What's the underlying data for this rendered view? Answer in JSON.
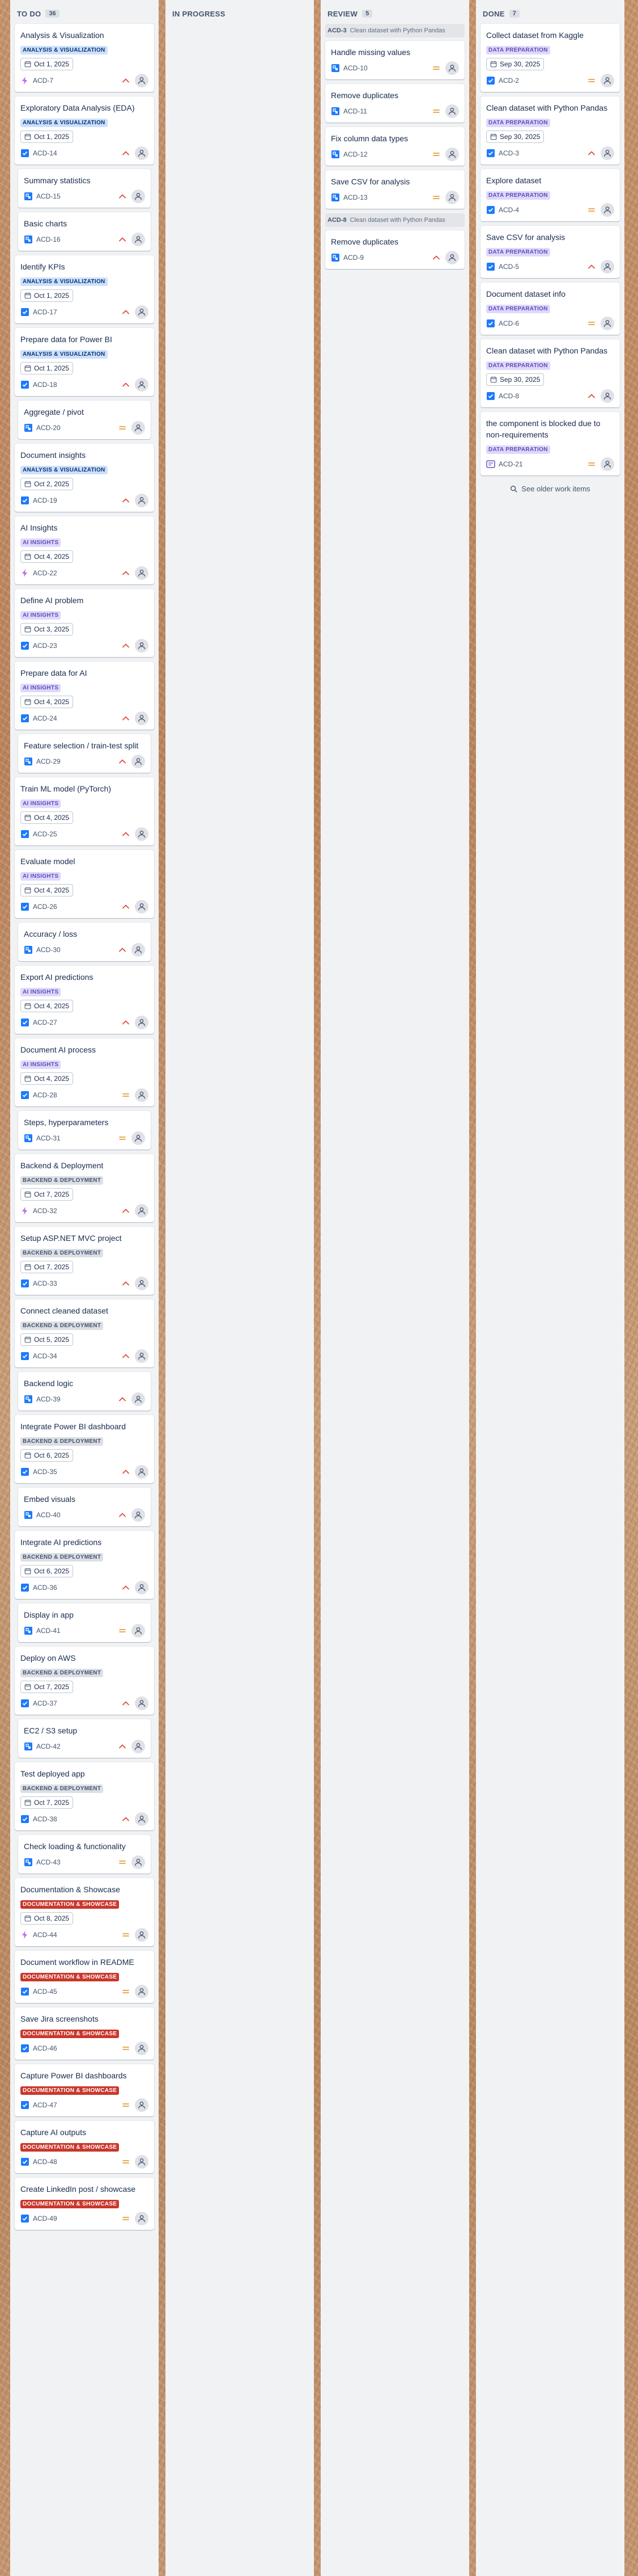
{
  "colors": {
    "analysis": {
      "bg": "#cce0ff",
      "fg": "#09326c"
    },
    "ai": {
      "bg": "#dfd8fd",
      "fg": "#5e4db2"
    },
    "backend": {
      "bg": "#dcdfe4",
      "fg": "#44546f"
    },
    "docs": {
      "bg": "#c9372c",
      "fg": "#ffffff"
    },
    "dataprep": {
      "bg": "#dfd8fd",
      "fg": "#5e4db2"
    }
  },
  "columns": {
    "todo": {
      "title": "TO DO",
      "count": "36",
      "cards": [
        {
          "title": "Analysis & Visualization",
          "epic": "ANALYSIS & VISUALIZATION",
          "epic_style": "analysis",
          "date": "Oct 1, 2025",
          "key": "ACD-7",
          "type": "epic-icon",
          "priority": "high-priority-icon"
        },
        {
          "title": "Exploratory Data Analysis (EDA)",
          "epic": "ANALYSIS & VISUALIZATION",
          "epic_style": "analysis",
          "date": "Oct 1, 2025",
          "key": "ACD-14",
          "type": "task-icon",
          "priority": "high-priority-icon"
        },
        {
          "title": "Summary statistics",
          "key": "ACD-15",
          "type": "subtask-icon",
          "priority": "high-priority-icon",
          "sub": true
        },
        {
          "title": "Basic charts",
          "key": "ACD-16",
          "type": "subtask-icon",
          "priority": "high-priority-icon",
          "sub": true
        },
        {
          "title": "Identify KPIs",
          "epic": "ANALYSIS & VISUALIZATION",
          "epic_style": "analysis",
          "date": "Oct 1, 2025",
          "key": "ACD-17",
          "type": "task-icon",
          "priority": "high-priority-icon"
        },
        {
          "title": "Prepare data for Power BI",
          "epic": "ANALYSIS & VISUALIZATION",
          "epic_style": "analysis",
          "date": "Oct 1, 2025",
          "key": "ACD-18",
          "type": "task-icon",
          "priority": "high-priority-icon"
        },
        {
          "title": "Aggregate / pivot",
          "key": "ACD-20",
          "type": "subtask-icon",
          "priority": "medium-priority-icon",
          "sub": true
        },
        {
          "title": "Document insights",
          "epic": "ANALYSIS & VISUALIZATION",
          "epic_style": "analysis",
          "date": "Oct 2, 2025",
          "key": "ACD-19",
          "type": "task-icon",
          "priority": "high-priority-icon"
        },
        {
          "title": "AI Insights",
          "epic": "AI INSIGHTS",
          "epic_style": "ai",
          "date": "Oct 4, 2025",
          "key": "ACD-22",
          "type": "epic-icon",
          "priority": "high-priority-icon"
        },
        {
          "title": "Define AI problem",
          "epic": "AI INSIGHTS",
          "epic_style": "ai",
          "date": "Oct 3, 2025",
          "key": "ACD-23",
          "type": "task-icon",
          "priority": "high-priority-icon"
        },
        {
          "title": "Prepare data for AI",
          "epic": "AI INSIGHTS",
          "epic_style": "ai",
          "date": "Oct 4, 2025",
          "key": "ACD-24",
          "type": "task-icon",
          "priority": "high-priority-icon"
        },
        {
          "title": "Feature selection / train-test split",
          "key": "ACD-29",
          "type": "subtask-icon",
          "priority": "high-priority-icon",
          "sub": true
        },
        {
          "title": "Train ML model (PyTorch)",
          "epic": "AI INSIGHTS",
          "epic_style": "ai",
          "date": "Oct 4, 2025",
          "key": "ACD-25",
          "type": "task-icon",
          "priority": "high-priority-icon"
        },
        {
          "title": "Evaluate model",
          "epic": "AI INSIGHTS",
          "epic_style": "ai",
          "date": "Oct 4, 2025",
          "key": "ACD-26",
          "type": "task-icon",
          "priority": "high-priority-icon"
        },
        {
          "title": "Accuracy / loss",
          "key": "ACD-30",
          "type": "subtask-icon",
          "priority": "high-priority-icon",
          "sub": true
        },
        {
          "title": "Export AI predictions",
          "epic": "AI INSIGHTS",
          "epic_style": "ai",
          "date": "Oct 4, 2025",
          "key": "ACD-27",
          "type": "task-icon",
          "priority": "high-priority-icon"
        },
        {
          "title": "Document AI process",
          "epic": "AI INSIGHTS",
          "epic_style": "ai",
          "date": "Oct 4, 2025",
          "key": "ACD-28",
          "type": "task-icon",
          "priority": "medium-priority-icon"
        },
        {
          "title": "Steps, hyperparameters",
          "key": "ACD-31",
          "type": "subtask-icon",
          "priority": "medium-priority-icon",
          "sub": true
        },
        {
          "title": "Backend & Deployment",
          "epic": "BACKEND & DEPLOYMENT",
          "epic_style": "backend",
          "date": "Oct 7, 2025",
          "key": "ACD-32",
          "type": "epic-icon",
          "priority": "high-priority-icon"
        },
        {
          "title": "Setup ASP.NET MVC project",
          "epic": "BACKEND & DEPLOYMENT",
          "epic_style": "backend",
          "date": "Oct 7, 2025",
          "key": "ACD-33",
          "type": "task-icon",
          "priority": "high-priority-icon"
        },
        {
          "title": "Connect cleaned dataset",
          "epic": "BACKEND & DEPLOYMENT",
          "epic_style": "backend",
          "date": "Oct 5, 2025",
          "key": "ACD-34",
          "type": "task-icon",
          "priority": "high-priority-icon"
        },
        {
          "title": "Backend logic",
          "key": "ACD-39",
          "type": "subtask-icon",
          "priority": "high-priority-icon",
          "sub": true
        },
        {
          "title": "Integrate Power BI dashboard",
          "epic": "BACKEND & DEPLOYMENT",
          "epic_style": "backend",
          "date": "Oct 6, 2025",
          "key": "ACD-35",
          "type": "task-icon",
          "priority": "high-priority-icon"
        },
        {
          "title": "Embed visuals",
          "key": "ACD-40",
          "type": "subtask-icon",
          "priority": "high-priority-icon",
          "sub": true
        },
        {
          "title": "Integrate AI predictions",
          "epic": "BACKEND & DEPLOYMENT",
          "epic_style": "backend",
          "date": "Oct 6, 2025",
          "key": "ACD-36",
          "type": "task-icon",
          "priority": "high-priority-icon"
        },
        {
          "title": "Display in app",
          "key": "ACD-41",
          "type": "subtask-icon",
          "priority": "medium-priority-icon",
          "sub": true
        },
        {
          "title": "Deploy on AWS",
          "epic": "BACKEND & DEPLOYMENT",
          "epic_style": "backend",
          "date": "Oct 7, 2025",
          "key": "ACD-37",
          "type": "task-icon",
          "priority": "high-priority-icon"
        },
        {
          "title": "EC2 / S3 setup",
          "key": "ACD-42",
          "type": "subtask-icon",
          "priority": "high-priority-icon",
          "sub": true
        },
        {
          "title": "Test deployed app",
          "epic": "BACKEND & DEPLOYMENT",
          "epic_style": "backend",
          "date": "Oct 7, 2025",
          "key": "ACD-38",
          "type": "task-icon",
          "priority": "high-priority-icon"
        },
        {
          "title": "Check loading & functionality",
          "key": "ACD-43",
          "type": "subtask-icon",
          "priority": "medium-priority-icon",
          "sub": true
        },
        {
          "title": "Documentation & Showcase",
          "epic": "DOCUMENTATION & SHOWCASE",
          "epic_style": "docs",
          "date": "Oct 8, 2025",
          "key": "ACD-44",
          "type": "epic-icon",
          "priority": "medium-priority-icon"
        },
        {
          "title": "Document workflow in README",
          "epic": "DOCUMENTATION & SHOWCASE",
          "epic_style": "docs",
          "key": "ACD-45",
          "type": "task-icon",
          "priority": "medium-priority-icon"
        },
        {
          "title": "Save Jira screenshots",
          "epic": "DOCUMENTATION & SHOWCASE",
          "epic_style": "docs",
          "key": "ACD-46",
          "type": "task-icon",
          "priority": "medium-priority-icon"
        },
        {
          "title": "Capture Power BI dashboards",
          "epic": "DOCUMENTATION & SHOWCASE",
          "epic_style": "docs",
          "key": "ACD-47",
          "type": "task-icon",
          "priority": "medium-priority-icon"
        },
        {
          "title": "Capture AI outputs",
          "epic": "DOCUMENTATION & SHOWCASE",
          "epic_style": "docs",
          "key": "ACD-48",
          "type": "task-icon",
          "priority": "medium-priority-icon"
        },
        {
          "title": "Create LinkedIn post / showcase",
          "epic": "DOCUMENTATION & SHOWCASE",
          "epic_style": "docs",
          "key": "ACD-49",
          "type": "task-icon",
          "priority": "medium-priority-icon"
        }
      ]
    },
    "inprogress": {
      "title": "IN PROGRESS"
    },
    "review": {
      "title": "REVIEW",
      "count": "5",
      "groups": [
        {
          "key": "ACD-3",
          "name": "Clean dataset with Python Pandas",
          "cards": [
            {
              "title": "Handle missing values",
              "key": "ACD-10",
              "type": "subtask-icon",
              "priority": "medium-priority-icon"
            },
            {
              "title": "Remove duplicates",
              "key": "ACD-11",
              "type": "subtask-icon",
              "priority": "medium-priority-icon"
            },
            {
              "title": "Fix column data types",
              "key": "ACD-12",
              "type": "subtask-icon",
              "priority": "medium-priority-icon"
            },
            {
              "title": "Save CSV for analysis",
              "key": "ACD-13",
              "type": "subtask-icon",
              "priority": "medium-priority-icon"
            }
          ]
        },
        {
          "key": "ACD-8",
          "name": "Clean dataset with Python Pandas",
          "cards": [
            {
              "title": "Remove duplicates",
              "key": "ACD-9",
              "type": "subtask-icon",
              "priority": "high-priority-icon"
            }
          ]
        }
      ]
    },
    "done": {
      "title": "DONE",
      "count": "7",
      "cards": [
        {
          "title": "Collect dataset from Kaggle",
          "epic": "DATA PREPARATION",
          "epic_style": "dataprep",
          "date": "Sep 30, 2025",
          "key": "ACD-2",
          "type": "task-icon",
          "priority": "medium-priority-icon"
        },
        {
          "title": "Clean dataset with Python Pandas",
          "epic": "DATA PREPARATION",
          "epic_style": "dataprep",
          "date": "Sep 30, 2025",
          "key": "ACD-3",
          "type": "task-icon",
          "priority": "high-priority-icon"
        },
        {
          "title": "Explore dataset",
          "epic": "DATA PREPARATION",
          "epic_style": "dataprep",
          "key": "ACD-4",
          "type": "task-icon",
          "priority": "medium-priority-icon"
        },
        {
          "title": "Save CSV for analysis",
          "epic": "DATA PREPARATION",
          "epic_style": "dataprep",
          "key": "ACD-5",
          "type": "task-icon",
          "priority": "high-priority-icon"
        },
        {
          "title": "Document dataset info",
          "epic": "DATA PREPARATION",
          "epic_style": "dataprep",
          "key": "ACD-6",
          "type": "task-icon",
          "priority": "medium-priority-icon"
        },
        {
          "title": "Clean dataset with Python Pandas",
          "epic": "DATA PREPARATION",
          "epic_style": "dataprep",
          "date": "Sep 30, 2025",
          "key": "ACD-8",
          "type": "task-icon",
          "priority": "high-priority-icon"
        },
        {
          "title": "the component is blocked due to non-requirements",
          "epic": "DATA PREPARATION",
          "epic_style": "dataprep",
          "key": "ACD-21",
          "type": "story-icon",
          "priority": "medium-priority-icon"
        }
      ],
      "older_label": "See older work items"
    }
  }
}
